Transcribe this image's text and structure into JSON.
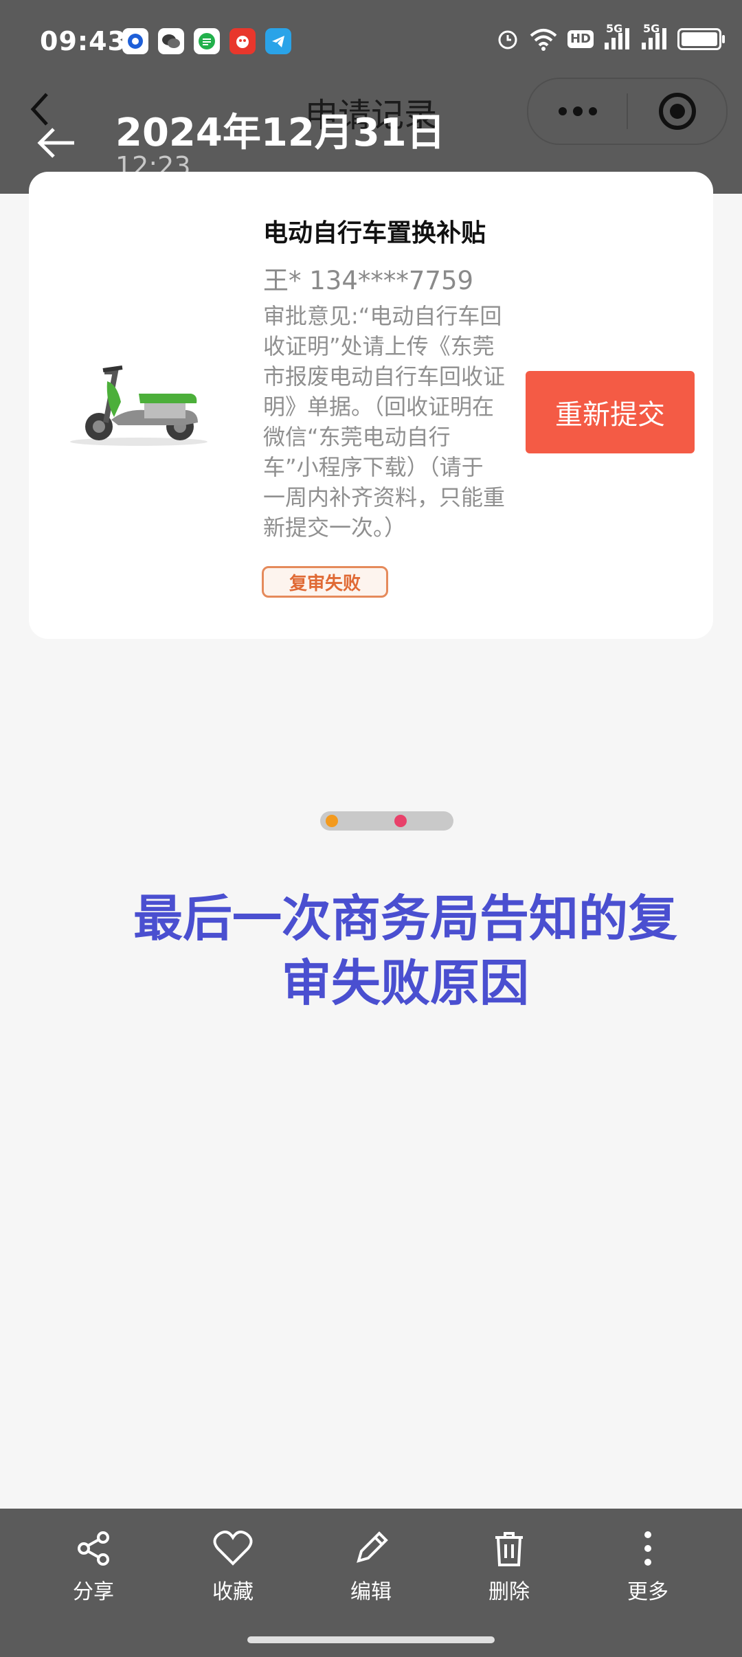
{
  "status_bar": {
    "time": "09:43",
    "hd_label": "HD",
    "network_1": "5G",
    "network_2": "5G"
  },
  "mini_program": {
    "title": "申请记录"
  },
  "viewer": {
    "date": "2024年12月31日",
    "time": "12:23"
  },
  "card": {
    "title": "电动自行车置换补贴",
    "applicant": "王* 134****7759",
    "opinion": "审批意见:“电动自行车回收证明”处请上传《东莞市报废电动自行车回收证明》单据。（回收证明在微信“东莞电动自行车”小程序下载）（请于一周内补齐资料，只能重新提交一次。）",
    "status": "复审失败",
    "button": "重新提交"
  },
  "annotation": {
    "line1": "最后一次商务局告知的复",
    "line2": "审失败原因"
  },
  "toolbar": {
    "share": "分享",
    "favorite": "收藏",
    "edit": "编辑",
    "delete": "删除",
    "more": "更多"
  },
  "colors": {
    "overlay": "#5b5b5b",
    "accent_button": "#f45b45",
    "status_tag": "#e06a35",
    "annotation": "#4a4fd0"
  }
}
